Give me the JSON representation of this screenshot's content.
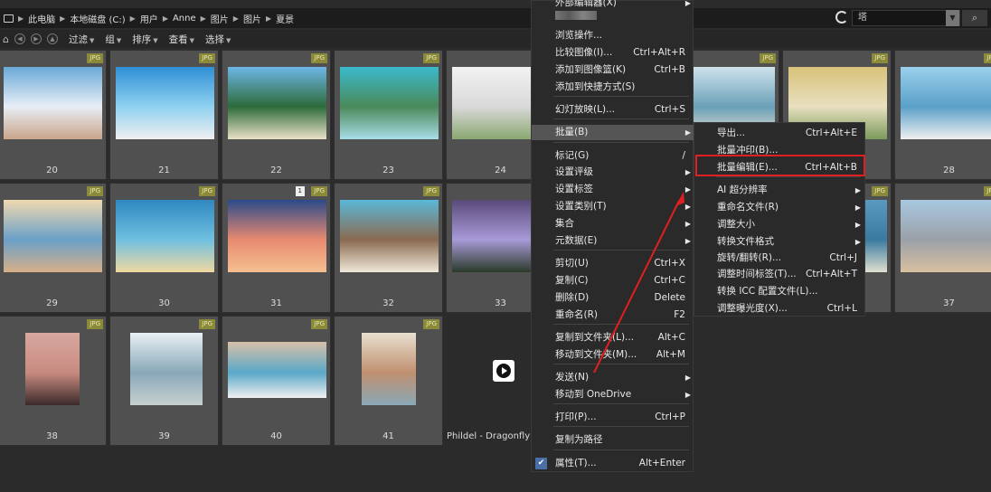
{
  "breadcrumb": {
    "items": [
      "此电脑",
      "本地磁盘 (C:)",
      "用户",
      "Anne",
      "图片",
      "图片",
      "夏景"
    ]
  },
  "search": {
    "value": "塔"
  },
  "toolbar": {
    "items": [
      "过滤",
      "组",
      "排序",
      "查看",
      "选择"
    ]
  },
  "thumbnails": [
    {
      "num": "20",
      "badge": "JPG"
    },
    {
      "num": "21",
      "badge": "JPG"
    },
    {
      "num": "22",
      "badge": "JPG"
    },
    {
      "num": "23",
      "badge": "JPG"
    },
    {
      "num": "24",
      "badge": ""
    },
    {
      "num": "",
      "badge": ""
    },
    {
      "num": "",
      "badge": "JPG"
    },
    {
      "num": "",
      "badge": "JPG"
    },
    {
      "num": "28",
      "badge": "JPG"
    },
    {
      "num": "29",
      "badge": "JPG"
    },
    {
      "num": "30",
      "badge": "JPG"
    },
    {
      "num": "31",
      "badge": "JPG",
      "page": "1"
    },
    {
      "num": "32",
      "badge": "JPG"
    },
    {
      "num": "33",
      "badge": ""
    },
    {
      "num": "",
      "badge": ""
    },
    {
      "num": "",
      "badge": ""
    },
    {
      "num": "",
      "badge": "JPG"
    },
    {
      "num": "37",
      "badge": "JPG"
    },
    {
      "num": "38",
      "badge": "JPG"
    },
    {
      "num": "39",
      "badge": "JPG"
    },
    {
      "num": "40",
      "badge": "JPG"
    },
    {
      "num": "41",
      "badge": "JPG"
    },
    {
      "num": "Phildel - Dragonfly",
      "badge": ""
    }
  ],
  "context_menu": {
    "items": [
      {
        "label": "外部编辑器(X)",
        "shortcut": "",
        "arrow": true
      },
      {
        "label": "浏览操作...",
        "shortcut": ""
      },
      {
        "label": "比较图像(I)...",
        "shortcut": "Ctrl+Alt+R"
      },
      {
        "label": "添加到图像篮(K)",
        "shortcut": "Ctrl+B"
      },
      {
        "label": "添加到快捷方式(S)",
        "shortcut": ""
      },
      {
        "label": "幻灯放映(L)...",
        "shortcut": "Ctrl+S"
      },
      {
        "label": "批量(B)",
        "shortcut": "",
        "arrow": true
      },
      {
        "label": "标记(G)",
        "shortcut": "/"
      },
      {
        "label": "设置评级",
        "shortcut": "",
        "arrow": true
      },
      {
        "label": "设置标签",
        "shortcut": "",
        "arrow": true
      },
      {
        "label": "设置类别(T)",
        "shortcut": "",
        "arrow": true
      },
      {
        "label": "集合",
        "shortcut": "",
        "arrow": true
      },
      {
        "label": "元数据(E)",
        "shortcut": "",
        "arrow": true
      },
      {
        "label": "剪切(U)",
        "shortcut": "Ctrl+X"
      },
      {
        "label": "复制(C)",
        "shortcut": "Ctrl+C"
      },
      {
        "label": "删除(D)",
        "shortcut": "Delete"
      },
      {
        "label": "重命名(R)",
        "shortcut": "F2"
      },
      {
        "label": "复制到文件夹(L)...",
        "shortcut": "Alt+C"
      },
      {
        "label": "移动到文件夹(M)...",
        "shortcut": "Alt+M"
      },
      {
        "label": "发送(N)",
        "shortcut": "",
        "arrow": true
      },
      {
        "label": "移动到 OneDrive",
        "shortcut": "",
        "arrow": true
      },
      {
        "label": "打印(P)...",
        "shortcut": "Ctrl+P"
      },
      {
        "label": "复制为路径",
        "shortcut": ""
      },
      {
        "label": "属性(T)...",
        "shortcut": "Alt+Enter"
      }
    ]
  },
  "submenu": {
    "items": [
      {
        "label": "导出...",
        "shortcut": "Ctrl+Alt+E"
      },
      {
        "label": "批量冲印(B)...",
        "shortcut": ""
      },
      {
        "label": "批量编辑(E)...",
        "shortcut": "Ctrl+Alt+B"
      },
      {
        "label": "AI 超分辨率",
        "shortcut": "",
        "arrow": true
      },
      {
        "label": "重命名文件(R)",
        "shortcut": "",
        "arrow": true
      },
      {
        "label": "调整大小",
        "shortcut": "",
        "arrow": true
      },
      {
        "label": "转换文件格式",
        "shortcut": "",
        "arrow": true
      },
      {
        "label": "旋转/翻转(R)...",
        "shortcut": "Ctrl+J"
      },
      {
        "label": "调整时间标签(T)...",
        "shortcut": "Ctrl+Alt+T"
      },
      {
        "label": "转换 ICC 配置文件(L)...",
        "shortcut": ""
      },
      {
        "label": "调整曝光度(X)...",
        "shortcut": "Ctrl+L"
      }
    ]
  }
}
